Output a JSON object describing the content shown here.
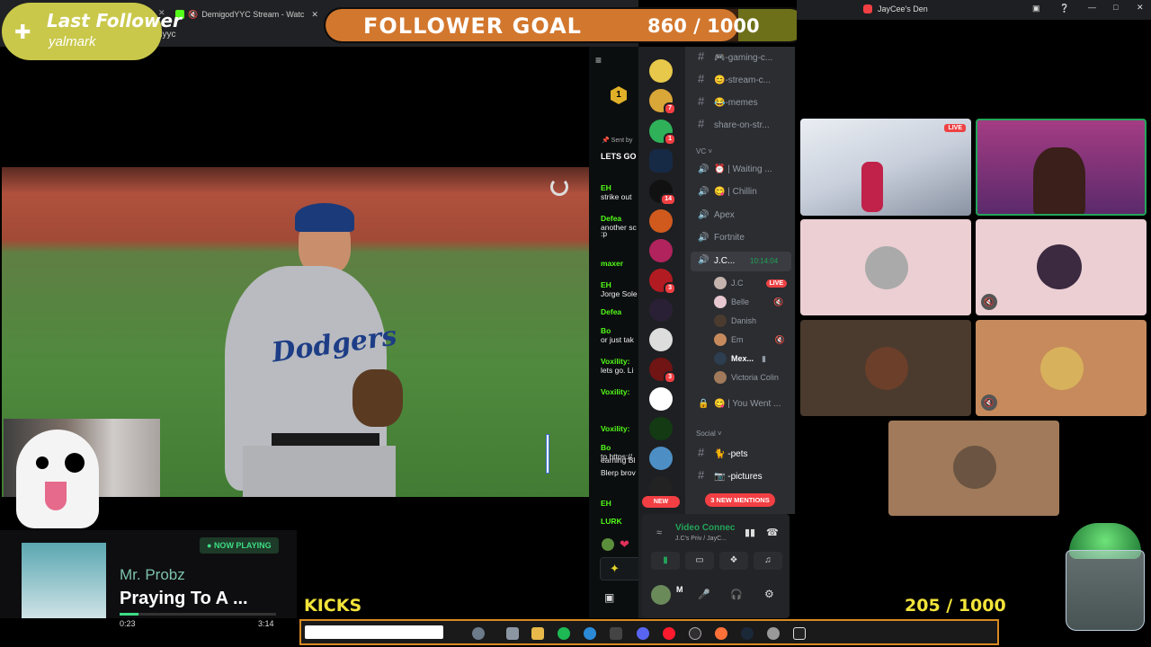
{
  "browser": {
    "tabs": [
      "DemigodYYC Stream - Watc",
      ""
    ],
    "url": "dyyc"
  },
  "overlay": {
    "last_follower_title": "Last Follower",
    "last_follower_name": "yalmark",
    "goal_title": "FOLLOWER GOAL",
    "goal_count": "860 / 1000",
    "kicks_label": "KICKS",
    "kicks_count": "205 / 1000"
  },
  "music": {
    "status": "NOW PLAYING",
    "artist": "Mr. Probz",
    "track": "Praying To A ...",
    "elapsed": "0:23",
    "duration": "3:14",
    "progress": 0.12
  },
  "kick_chat": {
    "pinned_label": "Sent by",
    "pinned_text": "LETS GO",
    "leader_rank": "1",
    "messages": [
      {
        "user": "EH",
        "text": "strike out"
      },
      {
        "user": "Defea",
        "text": "another sc"
      },
      {
        "user": "",
        "text": ":p"
      },
      {
        "user": "maxer",
        "text": ""
      },
      {
        "user": "EH",
        "text": "Jorge Sole"
      },
      {
        "user": "Defea",
        "text": ""
      },
      {
        "user": "Bo",
        "text": "or just tak"
      },
      {
        "user": "Voxility:",
        "text": "lets go. Li"
      },
      {
        "user": "Voxility:",
        "text": ""
      },
      {
        "user": "Voxility:",
        "text": ""
      },
      {
        "user": "Bo",
        "text": "to https://"
      },
      {
        "user": "",
        "text": "earning Bl"
      },
      {
        "user": "",
        "text": "Blerp brov"
      },
      {
        "user": "EH",
        "text": ""
      },
      {
        "user": "LURK",
        "text": ""
      }
    ]
  },
  "discord": {
    "window_title": "JayCee's Den",
    "server_badges": [
      "7",
      "1",
      "14",
      "3",
      "3"
    ],
    "channels": [
      {
        "name": "🎮-gaming-c..."
      },
      {
        "name": "😊-stream-c..."
      },
      {
        "name": "😂-memes"
      },
      {
        "name": "share-on-str..."
      }
    ],
    "vc_category": "VC",
    "voice_channels": [
      {
        "name": "| Waiting ..."
      },
      {
        "name": "| Chillin"
      },
      {
        "name": "Apex"
      },
      {
        "name": "Fortnite"
      },
      {
        "name": "J.C...",
        "timer": "10:14:04"
      }
    ],
    "voice_users": [
      {
        "name": "J.C",
        "badge": "LIVE"
      },
      {
        "name": "Belle"
      },
      {
        "name": "Danish"
      },
      {
        "name": "Em"
      },
      {
        "name": "Mex..."
      },
      {
        "name": "Victoria Colin"
      }
    ],
    "locked_channel": "| You Went ...",
    "social_category": "Social",
    "social_channels": [
      {
        "name": "-pets"
      },
      {
        "name": "-pictures"
      }
    ],
    "new_mentions": "3 NEW MENTIONS",
    "new_pill": "NEW",
    "voice_status": "Video Connec",
    "voice_sub": "J.C's Priv / JayC...",
    "user_short": "M",
    "live_badge": "LIVE"
  },
  "colors": {
    "goal_fill": "#d2772e",
    "goal_bg": "#6d7019",
    "accent_green": "#23a559",
    "kick_green": "#53fc18",
    "discord_red": "#f23f43",
    "kicks_yellow": "#f2e33a",
    "taskbar_border": "#d88a22"
  }
}
